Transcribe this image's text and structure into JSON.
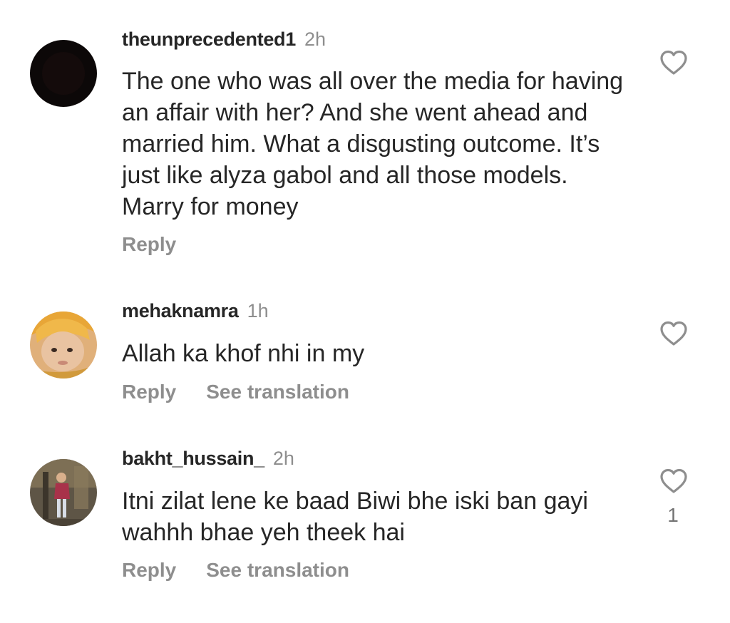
{
  "comments": [
    {
      "username": "theunprecedented1",
      "time": "2h",
      "text": "The one who was all over the media for having an affair with her? And she went ahead and married him. What a disgusting outcome. It’s just like alyza gabol and all those models. Marry for money",
      "actions": {
        "reply": "Reply"
      },
      "avatar": {
        "icon": "avatar-dark",
        "color": "#0c0c0c"
      },
      "like_icon": "heart-outline-icon"
    },
    {
      "username": "mehaknamra",
      "time": "1h",
      "text": "Allah ka khof nhi in my",
      "actions": {
        "reply": "Reply",
        "translate": "See translation"
      },
      "avatar": {
        "icon": "avatar-photo-child",
        "color": "#d5a06c"
      },
      "like_icon": "heart-outline-icon"
    },
    {
      "username": "bakht_hussain_",
      "time": "2h",
      "text": "Itni zilat lene ke baad Biwi bhe iski ban gayi wahhh bhae yeh theek hai",
      "actions": {
        "reply": "Reply",
        "translate": "See translation"
      },
      "avatar": {
        "icon": "avatar-photo-person",
        "color": "#6b5e4a"
      },
      "like_icon": "heart-outline-icon",
      "likes": "1"
    }
  ],
  "colors": {
    "text": "#262626",
    "muted": "#8e8e8e",
    "background": "#ffffff"
  }
}
